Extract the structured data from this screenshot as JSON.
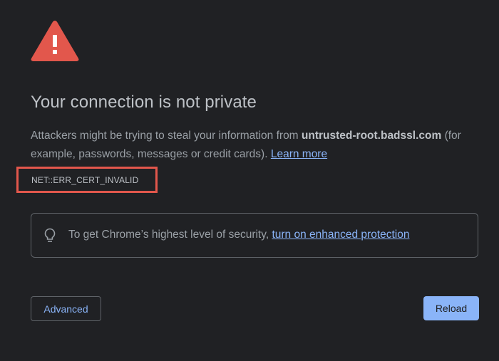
{
  "colors": {
    "background": "#202124",
    "warning_red": "#e2574c",
    "link_blue": "#8ab4f8",
    "highlight_border": "#e2574c"
  },
  "icons": {
    "warning": "warning-triangle-icon",
    "tip": "lightbulb-icon"
  },
  "header": {
    "title": "Your connection is not private"
  },
  "explanation": {
    "prefix": "Attackers might be trying to steal your information from ",
    "domain": "untrusted-root.badssl.com",
    "suffix": " (for example, passwords, messages or credit cards). ",
    "learn_more": "Learn more"
  },
  "error": {
    "code": "NET::ERR_CERT_INVALID"
  },
  "enhanced_protection": {
    "text": "To get Chrome’s highest level of security, ",
    "link": "turn on enhanced protection"
  },
  "buttons": {
    "advanced": "Advanced",
    "reload": "Reload"
  }
}
